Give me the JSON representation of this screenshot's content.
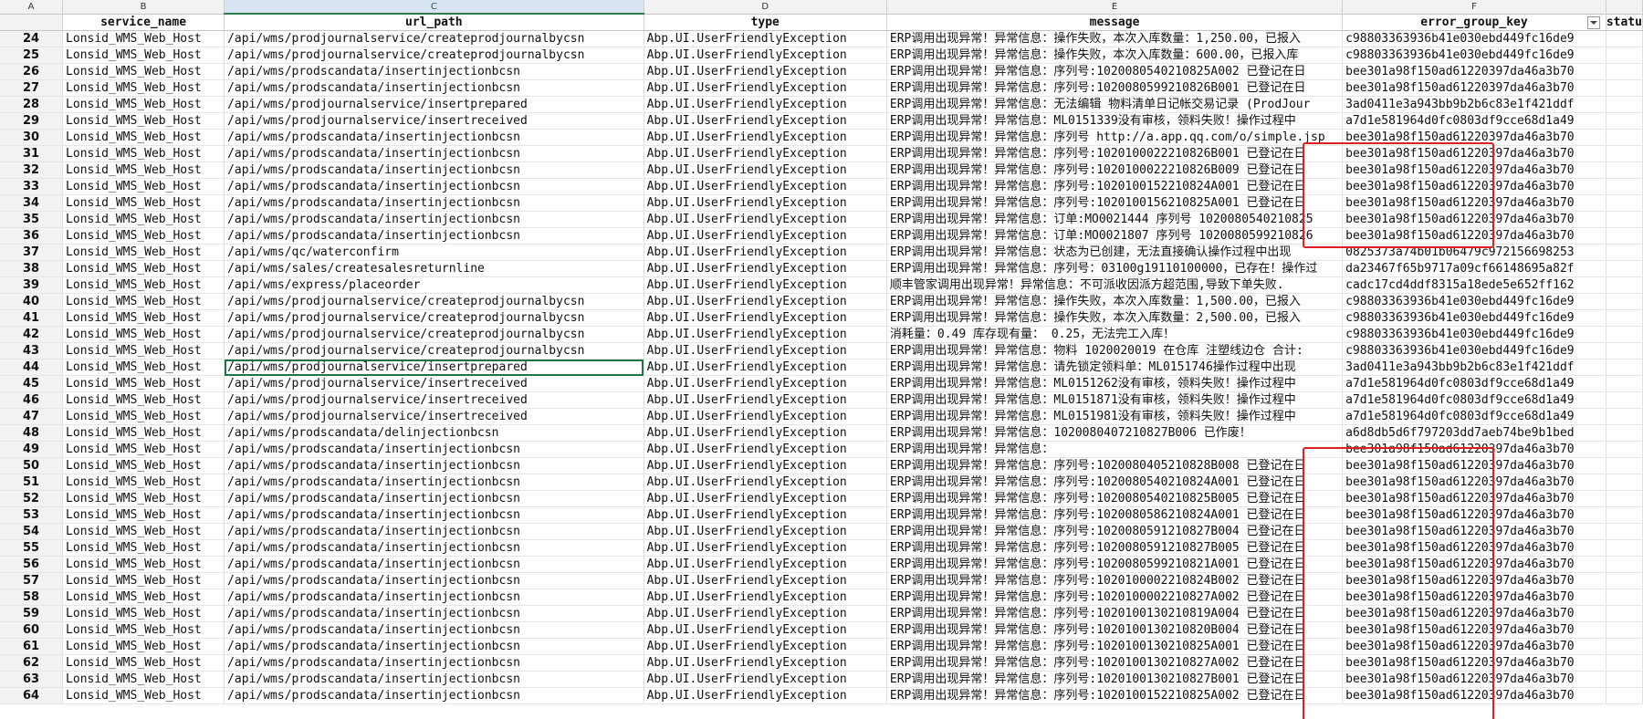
{
  "columns": {
    "letters": [
      "A",
      "B",
      "C",
      "D",
      "E",
      "F",
      ""
    ],
    "headers": [
      "",
      "service_name",
      "url_path",
      "type",
      "message",
      "error_group_key",
      "statu"
    ]
  },
  "rows": [
    {
      "n": "24",
      "service": "Lonsid_WMS_Web_Host",
      "url": "/api/wms/prodjournalservice/createprodjournalbycsn",
      "type": "Abp.UI.UserFriendlyException",
      "message": "ERP调用出现异常！异常信息：操作失败，本次入库数量：1,250.00，已报入",
      "key": "c98803363936b41e030ebd449fc16de9"
    },
    {
      "n": "25",
      "service": "Lonsid_WMS_Web_Host",
      "url": "/api/wms/prodjournalservice/createprodjournalbycsn",
      "type": "Abp.UI.UserFriendlyException",
      "message": "ERP调用出现异常！异常信息：操作失败，本次入库数量：600.00，已报入库",
      "key": "c98803363936b41e030ebd449fc16de9"
    },
    {
      "n": "26",
      "service": "Lonsid_WMS_Web_Host",
      "url": "/api/wms/prodscandata/insertinjectionbcsn",
      "type": "Abp.UI.UserFriendlyException",
      "message": "ERP调用出现异常！异常信息：序列号:1020080540210825A002 已登记在日",
      "key": "bee301a98f150ad61220397da46a3b70"
    },
    {
      "n": "27",
      "service": "Lonsid_WMS_Web_Host",
      "url": "/api/wms/prodscandata/insertinjectionbcsn",
      "type": "Abp.UI.UserFriendlyException",
      "message": "ERP调用出现异常！异常信息：序列号:1020080599210826B001 已登记在日",
      "key": "bee301a98f150ad61220397da46a3b70"
    },
    {
      "n": "28",
      "service": "Lonsid_WMS_Web_Host",
      "url": "/api/wms/prodjournalservice/insertprepared",
      "type": "Abp.UI.UserFriendlyException",
      "message": "ERP调用出现异常！异常信息：无法编辑 物料清单日记帐交易记录 (ProdJour",
      "key": "3ad0411e3a943bb9b2b6c83e1f421ddf"
    },
    {
      "n": "29",
      "service": "Lonsid_WMS_Web_Host",
      "url": "/api/wms/prodjournalservice/insertreceived",
      "type": "Abp.UI.UserFriendlyException",
      "message": "ERP调用出现异常！异常信息：ML0151339没有审核，领料失败！操作过程中",
      "key": "a7d1e581964d0fc0803df9cce68d1a49"
    },
    {
      "n": "30",
      "service": "Lonsid_WMS_Web_Host",
      "url": "/api/wms/prodscandata/insertinjectionbcsn",
      "type": "Abp.UI.UserFriendlyException",
      "message": "ERP调用出现异常！异常信息：序列号 http://a.app.qq.com/o/simple.jsp",
      "key": "bee301a98f150ad61220397da46a3b70"
    },
    {
      "n": "31",
      "service": "Lonsid_WMS_Web_Host",
      "url": "/api/wms/prodscandata/insertinjectionbcsn",
      "type": "Abp.UI.UserFriendlyException",
      "message": "ERP调用出现异常！异常信息：序列号:1020100022210826B001 已登记在日",
      "key": "bee301a98f150ad61220397da46a3b70"
    },
    {
      "n": "32",
      "service": "Lonsid_WMS_Web_Host",
      "url": "/api/wms/prodscandata/insertinjectionbcsn",
      "type": "Abp.UI.UserFriendlyException",
      "message": "ERP调用出现异常！异常信息：序列号:1020100022210826B009 已登记在日",
      "key": "bee301a98f150ad61220397da46a3b70"
    },
    {
      "n": "33",
      "service": "Lonsid_WMS_Web_Host",
      "url": "/api/wms/prodscandata/insertinjectionbcsn",
      "type": "Abp.UI.UserFriendlyException",
      "message": "ERP调用出现异常！异常信息：序列号:1020100152210824A001 已登记在日",
      "key": "bee301a98f150ad61220397da46a3b70"
    },
    {
      "n": "34",
      "service": "Lonsid_WMS_Web_Host",
      "url": "/api/wms/prodscandata/insertinjectionbcsn",
      "type": "Abp.UI.UserFriendlyException",
      "message": "ERP调用出现异常！异常信息：序列号:1020100156210825A001 已登记在日",
      "key": "bee301a98f150ad61220397da46a3b70"
    },
    {
      "n": "35",
      "service": "Lonsid_WMS_Web_Host",
      "url": "/api/wms/prodscandata/insertinjectionbcsn",
      "type": "Abp.UI.UserFriendlyException",
      "message": "ERP调用出现异常！异常信息：订单:MO0021444 序列号 1020080540210825",
      "key": "bee301a98f150ad61220397da46a3b70"
    },
    {
      "n": "36",
      "service": "Lonsid_WMS_Web_Host",
      "url": "/api/wms/prodscandata/insertinjectionbcsn",
      "type": "Abp.UI.UserFriendlyException",
      "message": "ERP调用出现异常！异常信息：订单:MO0021807 序列号 1020080599210826",
      "key": "bee301a98f150ad61220397da46a3b70"
    },
    {
      "n": "37",
      "service": "Lonsid_WMS_Web_Host",
      "url": "/api/wms/qc/waterconfirm",
      "type": "Abp.UI.UserFriendlyException",
      "message": "ERP调用出现异常！异常信息：状态为已创建，无法直接确认操作过程中出现",
      "key": "0825373a74b01b06479c972156698253"
    },
    {
      "n": "38",
      "service": "Lonsid_WMS_Web_Host",
      "url": "/api/wms/sales/createsalesreturnline",
      "type": "Abp.UI.UserFriendlyException",
      "message": "ERP调用出现异常！异常信息：序列号：03100g19110100000，已存在！操作过",
      "key": "da23467f65b9717a09cf66148695a82f"
    },
    {
      "n": "39",
      "service": "Lonsid_WMS_Web_Host",
      "url": "/api/wms/express/placeorder",
      "type": "Abp.UI.UserFriendlyException",
      "message": "顺丰管家调用出现异常！异常信息：不可派收因派方超范围,导致下单失败.",
      "key": "cadc17cd4ddf8315a18ede5e652ff162"
    },
    {
      "n": "40",
      "service": "Lonsid_WMS_Web_Host",
      "url": "/api/wms/prodjournalservice/createprodjournalbycsn",
      "type": "Abp.UI.UserFriendlyException",
      "message": "ERP调用出现异常！异常信息：操作失败，本次入库数量：1,500.00，已报入",
      "key": "c98803363936b41e030ebd449fc16de9"
    },
    {
      "n": "41",
      "service": "Lonsid_WMS_Web_Host",
      "url": "/api/wms/prodjournalservice/createprodjournalbycsn",
      "type": "Abp.UI.UserFriendlyException",
      "message": "ERP调用出现异常！异常信息：操作失败，本次入库数量：2,500.00，已报入",
      "key": "c98803363936b41e030ebd449fc16de9"
    },
    {
      "n": "42",
      "service": "Lonsid_WMS_Web_Host",
      "url": "/api/wms/prodjournalservice/createprodjournalbycsn",
      "type": "Abp.UI.UserFriendlyException",
      "message": "消耗量：0.49 库存现有量： 0.25，无法完工入库！",
      "key": "c98803363936b41e030ebd449fc16de9"
    },
    {
      "n": "43",
      "service": "Lonsid_WMS_Web_Host",
      "url": "/api/wms/prodjournalservice/createprodjournalbycsn",
      "type": "Abp.UI.UserFriendlyException",
      "message": "ERP调用出现异常！异常信息：物料 1020020019 在仓库 注塑线边仓 合计:",
      "key": "c98803363936b41e030ebd449fc16de9"
    },
    {
      "n": "44",
      "service": "Lonsid_WMS_Web_Host",
      "url": "/api/wms/prodjournalservice/insertprepared",
      "type": "Abp.UI.UserFriendlyException",
      "message": "ERP调用出现异常！异常信息：请先锁定领料单：ML0151746操作过程中出现",
      "key": "3ad0411e3a943bb9b2b6c83e1f421ddf",
      "selected": true
    },
    {
      "n": "45",
      "service": "Lonsid_WMS_Web_Host",
      "url": "/api/wms/prodjournalservice/insertreceived",
      "type": "Abp.UI.UserFriendlyException",
      "message": "ERP调用出现异常！异常信息：ML0151262没有审核，领料失败！操作过程中",
      "key": "a7d1e581964d0fc0803df9cce68d1a49"
    },
    {
      "n": "46",
      "service": "Lonsid_WMS_Web_Host",
      "url": "/api/wms/prodjournalservice/insertreceived",
      "type": "Abp.UI.UserFriendlyException",
      "message": "ERP调用出现异常！异常信息：ML0151871没有审核，领料失败！操作过程中",
      "key": "a7d1e581964d0fc0803df9cce68d1a49"
    },
    {
      "n": "47",
      "service": "Lonsid_WMS_Web_Host",
      "url": "/api/wms/prodjournalservice/insertreceived",
      "type": "Abp.UI.UserFriendlyException",
      "message": "ERP调用出现异常！异常信息：ML0151981没有审核，领料失败！操作过程中",
      "key": "a7d1e581964d0fc0803df9cce68d1a49"
    },
    {
      "n": "48",
      "service": "Lonsid_WMS_Web_Host",
      "url": "/api/wms/prodscandata/delinjectionbcsn",
      "type": "Abp.UI.UserFriendlyException",
      "message": "ERP调用出现异常！异常信息：1020080407210827B006 已作废！",
      "key": "a6d8db5d6f797203dd7aeb74be9b1bed"
    },
    {
      "n": "49",
      "service": "Lonsid_WMS_Web_Host",
      "url": "/api/wms/prodscandata/insertinjectionbcsn",
      "type": "Abp.UI.UserFriendlyException",
      "message": "ERP调用出现异常！异常信息：",
      "key": "bee301a98f150ad61220397da46a3b70"
    },
    {
      "n": "50",
      "service": "Lonsid_WMS_Web_Host",
      "url": "/api/wms/prodscandata/insertinjectionbcsn",
      "type": "Abp.UI.UserFriendlyException",
      "message": "ERP调用出现异常！异常信息：序列号:1020080405210828B008 已登记在日",
      "key": "bee301a98f150ad61220397da46a3b70"
    },
    {
      "n": "51",
      "service": "Lonsid_WMS_Web_Host",
      "url": "/api/wms/prodscandata/insertinjectionbcsn",
      "type": "Abp.UI.UserFriendlyException",
      "message": "ERP调用出现异常！异常信息：序列号:1020080540210824A001 已登记在日",
      "key": "bee301a98f150ad61220397da46a3b70"
    },
    {
      "n": "52",
      "service": "Lonsid_WMS_Web_Host",
      "url": "/api/wms/prodscandata/insertinjectionbcsn",
      "type": "Abp.UI.UserFriendlyException",
      "message": "ERP调用出现异常！异常信息：序列号:1020080540210825B005 已登记在日",
      "key": "bee301a98f150ad61220397da46a3b70"
    },
    {
      "n": "53",
      "service": "Lonsid_WMS_Web_Host",
      "url": "/api/wms/prodscandata/insertinjectionbcsn",
      "type": "Abp.UI.UserFriendlyException",
      "message": "ERP调用出现异常！异常信息：序列号:1020080586210824A001 已登记在日",
      "key": "bee301a98f150ad61220397da46a3b70"
    },
    {
      "n": "54",
      "service": "Lonsid_WMS_Web_Host",
      "url": "/api/wms/prodscandata/insertinjectionbcsn",
      "type": "Abp.UI.UserFriendlyException",
      "message": "ERP调用出现异常！异常信息：序列号:1020080591210827B004 已登记在日",
      "key": "bee301a98f150ad61220397da46a3b70"
    },
    {
      "n": "55",
      "service": "Lonsid_WMS_Web_Host",
      "url": "/api/wms/prodscandata/insertinjectionbcsn",
      "type": "Abp.UI.UserFriendlyException",
      "message": "ERP调用出现异常！异常信息：序列号:1020080591210827B005 已登记在日",
      "key": "bee301a98f150ad61220397da46a3b70"
    },
    {
      "n": "56",
      "service": "Lonsid_WMS_Web_Host",
      "url": "/api/wms/prodscandata/insertinjectionbcsn",
      "type": "Abp.UI.UserFriendlyException",
      "message": "ERP调用出现异常！异常信息：序列号:1020080599210821A001 已登记在日",
      "key": "bee301a98f150ad61220397da46a3b70"
    },
    {
      "n": "57",
      "service": "Lonsid_WMS_Web_Host",
      "url": "/api/wms/prodscandata/insertinjectionbcsn",
      "type": "Abp.UI.UserFriendlyException",
      "message": "ERP调用出现异常！异常信息：序列号:1020100002210824B002 已登记在日",
      "key": "bee301a98f150ad61220397da46a3b70"
    },
    {
      "n": "58",
      "service": "Lonsid_WMS_Web_Host",
      "url": "/api/wms/prodscandata/insertinjectionbcsn",
      "type": "Abp.UI.UserFriendlyException",
      "message": "ERP调用出现异常！异常信息：序列号:1020100002210827A002 已登记在日",
      "key": "bee301a98f150ad61220397da46a3b70"
    },
    {
      "n": "59",
      "service": "Lonsid_WMS_Web_Host",
      "url": "/api/wms/prodscandata/insertinjectionbcsn",
      "type": "Abp.UI.UserFriendlyException",
      "message": "ERP调用出现异常！异常信息：序列号:1020100130210819A004 已登记在日",
      "key": "bee301a98f150ad61220397da46a3b70"
    },
    {
      "n": "60",
      "service": "Lonsid_WMS_Web_Host",
      "url": "/api/wms/prodscandata/insertinjectionbcsn",
      "type": "Abp.UI.UserFriendlyException",
      "message": "ERP调用出现异常！异常信息：序列号:1020100130210820B004 已登记在日",
      "key": "bee301a98f150ad61220397da46a3b70"
    },
    {
      "n": "61",
      "service": "Lonsid_WMS_Web_Host",
      "url": "/api/wms/prodscandata/insertinjectionbcsn",
      "type": "Abp.UI.UserFriendlyException",
      "message": "ERP调用出现异常！异常信息：序列号:1020100130210825A001 已登记在日",
      "key": "bee301a98f150ad61220397da46a3b70"
    },
    {
      "n": "62",
      "service": "Lonsid_WMS_Web_Host",
      "url": "/api/wms/prodscandata/insertinjectionbcsn",
      "type": "Abp.UI.UserFriendlyException",
      "message": "ERP调用出现异常！异常信息：序列号:1020100130210827A002 已登记在日",
      "key": "bee301a98f150ad61220397da46a3b70"
    },
    {
      "n": "63",
      "service": "Lonsid_WMS_Web_Host",
      "url": "/api/wms/prodscandata/insertinjectionbcsn",
      "type": "Abp.UI.UserFriendlyException",
      "message": "ERP调用出现异常！异常信息：序列号:1020100130210827B001 已登记在日",
      "key": "bee301a98f150ad61220397da46a3b70"
    },
    {
      "n": "64",
      "service": "Lonsid_WMS_Web_Host",
      "url": "/api/wms/prodscandata/insertinjectionbcsn",
      "type": "Abp.UI.UserFriendlyException",
      "message": "ERP调用出现异常！异常信息：序列号:1020100152210825A002 已登记在日",
      "key": "bee301a98f150ad61220397da46a3b70"
    }
  ],
  "colors": {
    "highlight_box": "#e02020",
    "selection": "#217346",
    "header_bg": "#f2f2f2"
  }
}
